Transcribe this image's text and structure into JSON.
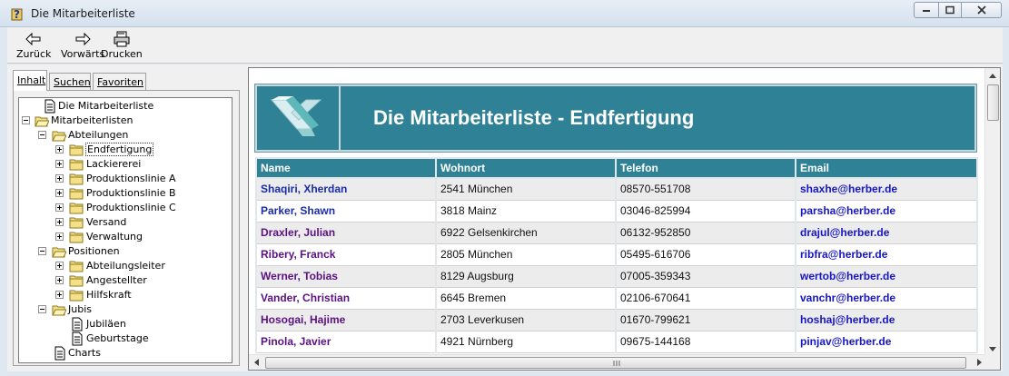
{
  "window": {
    "title": "Die Mitarbeiterliste"
  },
  "toolbar": {
    "back_label": "Zurück",
    "forward_label": "Vorwärts",
    "print_label": "Drucken"
  },
  "tabs": [
    {
      "label": "Inhalt"
    },
    {
      "label": "Suchen"
    },
    {
      "label": "Favoriten"
    }
  ],
  "tree": [
    {
      "label": "Die Mitarbeiterliste",
      "icon": "page-icon"
    },
    {
      "label": "Mitarbeiterlisten",
      "icon": "folder-open-icon"
    },
    {
      "label": "Abteilungen",
      "icon": "folder-open-icon"
    },
    {
      "label": "Endfertigung",
      "icon": "folder-icon"
    },
    {
      "label": "Lackiererei",
      "icon": "folder-icon"
    },
    {
      "label": "Produktionslinie A",
      "icon": "folder-icon"
    },
    {
      "label": "Produktionslinie B",
      "icon": "folder-icon"
    },
    {
      "label": "Produktionslinie C",
      "icon": "folder-icon"
    },
    {
      "label": "Versand",
      "icon": "folder-icon"
    },
    {
      "label": "Verwaltung",
      "icon": "folder-icon"
    },
    {
      "label": "Positionen",
      "icon": "folder-open-icon"
    },
    {
      "label": "Abteilungsleiter",
      "icon": "folder-icon"
    },
    {
      "label": "Angestellter",
      "icon": "folder-icon"
    },
    {
      "label": "Hilfskraft",
      "icon": "folder-icon"
    },
    {
      "label": "Jubis",
      "icon": "folder-open-icon"
    },
    {
      "label": "Jubiläen",
      "icon": "page-icon"
    },
    {
      "label": "Geburtstage",
      "icon": "page-icon"
    },
    {
      "label": "Charts",
      "icon": "page-icon"
    }
  ],
  "content": {
    "title": "Die Mitarbeiterliste - Endfertigung",
    "columns": [
      "Name",
      "Wohnort",
      "Telefon",
      "Email"
    ],
    "rows": [
      [
        "Shaqiri, Xherdan",
        "2541 München",
        "08570-551708",
        "shaxhe@herber.de"
      ],
      [
        "Parker, Shawn",
        "3818 Mainz",
        "03046-825994",
        "parsha@herber.de"
      ],
      [
        "Draxler, Julian",
        "6922 Gelsenkirchen",
        "06132-952850",
        "drajul@herber.de"
      ],
      [
        "Ribery, Franck",
        "2805 München",
        "05495-616706",
        "ribfra@herber.de"
      ],
      [
        "Werner, Tobias",
        "8129 Augsburg",
        "07005-359343",
        "wertob@herber.de"
      ],
      [
        "Vander, Christian",
        "6645 Bremen",
        "02106-670641",
        "vanchr@herber.de"
      ],
      [
        "Hosogai, Hajime",
        "2703 Leverkusen",
        "01670-799621",
        "hoshaj@herber.de"
      ],
      [
        "Pinola, Javier",
        "4921 Nürnberg",
        "09675-144168",
        "pinjav@herber.de"
      ]
    ]
  },
  "colors": {
    "banner": "#2f8195",
    "name_link": "#5a1280",
    "email_link": "#1616c8"
  }
}
